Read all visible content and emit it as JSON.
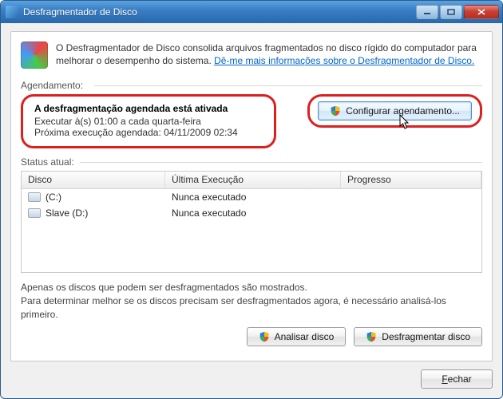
{
  "window": {
    "title": "Desfragmentador de Disco"
  },
  "intro": {
    "text": "O Desfragmentador de Disco consolida arquivos fragmentados no disco rígido do computador para melhorar o desempenho do sistema. ",
    "link": "Dê-me mais informações sobre o Desfragmentador de Disco."
  },
  "schedule": {
    "label": "Agendamento:",
    "line1": "A desfragmentação agendada está ativada",
    "line2": "Executar à(s) 01:00 a cada quarta-feira",
    "line3": "Próxima execução agendada: 04/11/2009 02:34",
    "configure_button": "Configurar agendamento..."
  },
  "status": {
    "label": "Status atual:"
  },
  "columns": {
    "disk": "Disco",
    "last_run": "Última Execução",
    "progress": "Progresso"
  },
  "disks": [
    {
      "name": "(C:)",
      "last_run": "Nunca executado",
      "progress": ""
    },
    {
      "name": "Slave (D:)",
      "last_run": "Nunca executado",
      "progress": ""
    }
  ],
  "hint": {
    "line1": "Apenas os discos que podem ser desfragmentados são mostrados.",
    "line2": "Para determinar melhor se os discos precisam ser desfragmentados agora, é necessário analisá-los primeiro."
  },
  "buttons": {
    "analyze": "Analisar disco",
    "defragment": "Desfragmentar disco",
    "close_prefix": "",
    "close_key": "F",
    "close_suffix": "echar"
  }
}
